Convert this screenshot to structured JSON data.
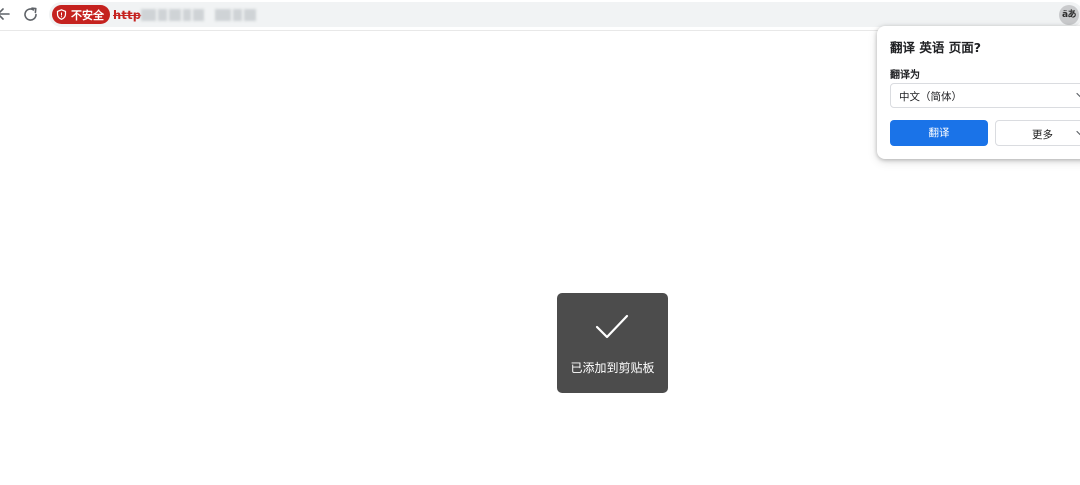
{
  "browser": {
    "security_chip_label": "不安全",
    "url_visible_prefix": "http",
    "translate_icon_label": "äあ"
  },
  "translate_popup": {
    "title": "翻译 英语 页面?",
    "target_label": "翻译为",
    "target_language": "中文（简体）",
    "translate_button": "翻译",
    "more_button": "更多"
  },
  "toast": {
    "message": "已添加到剪贴板"
  },
  "colors": {
    "danger": "#c5221f",
    "accent": "#1a73e8",
    "toast_bg": "#4c4c4c"
  }
}
